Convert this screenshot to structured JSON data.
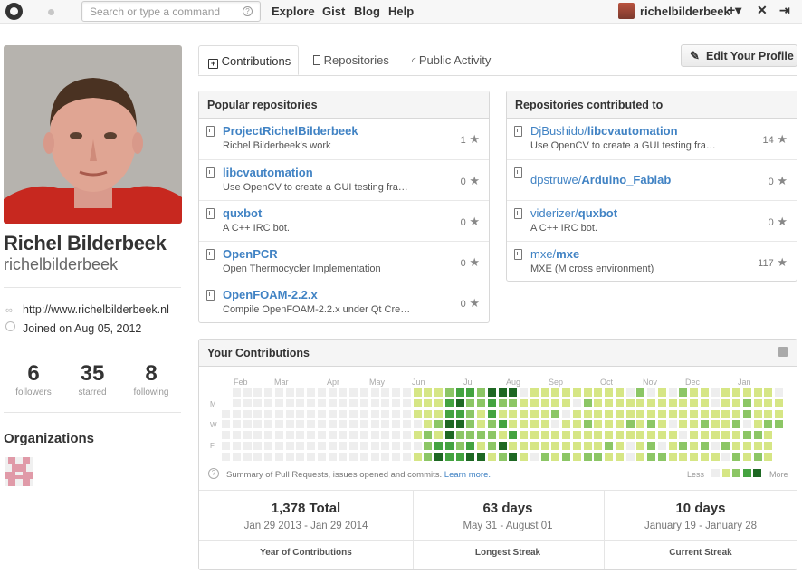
{
  "header": {
    "search_placeholder": "Search or type a command",
    "search_help": "?",
    "nav": [
      "Explore",
      "Gist",
      "Blog",
      "Help"
    ],
    "username": "richelbilderbeek",
    "add_icon": "+▾"
  },
  "profile": {
    "fullname": "Richel Bilderbeek",
    "login": "richelbilderbeek",
    "website": "http://www.richelbilderbeek.nl",
    "joined": "Joined on Aug 05, 2012",
    "stats": [
      {
        "value": "6",
        "label": "followers"
      },
      {
        "value": "35",
        "label": "starred"
      },
      {
        "value": "8",
        "label": "following"
      }
    ],
    "organizations_title": "Organizations"
  },
  "tabs": [
    "Contributions",
    "Repositories",
    "Public Activity"
  ],
  "edit_profile": "Edit Your Profile",
  "popular": {
    "title": "Popular repositories",
    "repos": [
      {
        "name": "ProjectRichelBilderbeek",
        "desc": "Richel Bilderbeek's work",
        "stars": "1"
      },
      {
        "name": "libcvautomation",
        "desc": "Use OpenCV to create a GUI testing fra…",
        "stars": "0"
      },
      {
        "name": "quxbot",
        "desc": "A C++ IRC bot.",
        "stars": "0"
      },
      {
        "name": "OpenPCR",
        "desc": "Open Thermocycler Implementation",
        "stars": "0"
      },
      {
        "name": "OpenFOAM-2.2.x",
        "desc": "Compile OpenFOAM-2.2.x under Qt Cre…",
        "stars": "0"
      }
    ]
  },
  "contributed": {
    "title": "Repositories contributed to",
    "repos": [
      {
        "owner": "DjBushido/",
        "name": "libcvautomation",
        "desc": "Use OpenCV to create a GUI testing fra…",
        "stars": "14"
      },
      {
        "owner": "dpstruwe/",
        "name": "Arduino_Fablab",
        "desc": "",
        "stars": "0"
      },
      {
        "owner": "viderizer/",
        "name": "quxbot",
        "desc": "A C++ IRC bot.",
        "stars": "0"
      },
      {
        "owner": "mxe/",
        "name": "mxe",
        "desc": "MXE (M cross environment)",
        "stars": "117"
      }
    ]
  },
  "contributions": {
    "title": "Your Contributions",
    "months": [
      "Feb",
      "Mar",
      "Apr",
      "May",
      "Jun",
      "Jul",
      "Aug",
      "Sep",
      "Oct",
      "Nov",
      "Dec",
      "Jan"
    ],
    "days": [
      "M",
      "W",
      "F"
    ],
    "note": "Summary of Pull Requests, issues opened and commits.",
    "learn_more": "Learn more.",
    "legend_less": "Less",
    "legend_more": "More",
    "colors": [
      "#eeeeee",
      "#d6e685",
      "#8cc665",
      "#44a340",
      "#1e6823"
    ],
    "summary": [
      {
        "big": "1,378 Total",
        "range": "Jan 29 2013 - Jan 29 2014",
        "label": "Year of Contributions"
      },
      {
        "big": "63 days",
        "range": "May 31 - August 01",
        "label": "Longest Streak"
      },
      {
        "big": "10 days",
        "range": "January 19 - January 28",
        "label": "Current Streak"
      }
    ]
  }
}
